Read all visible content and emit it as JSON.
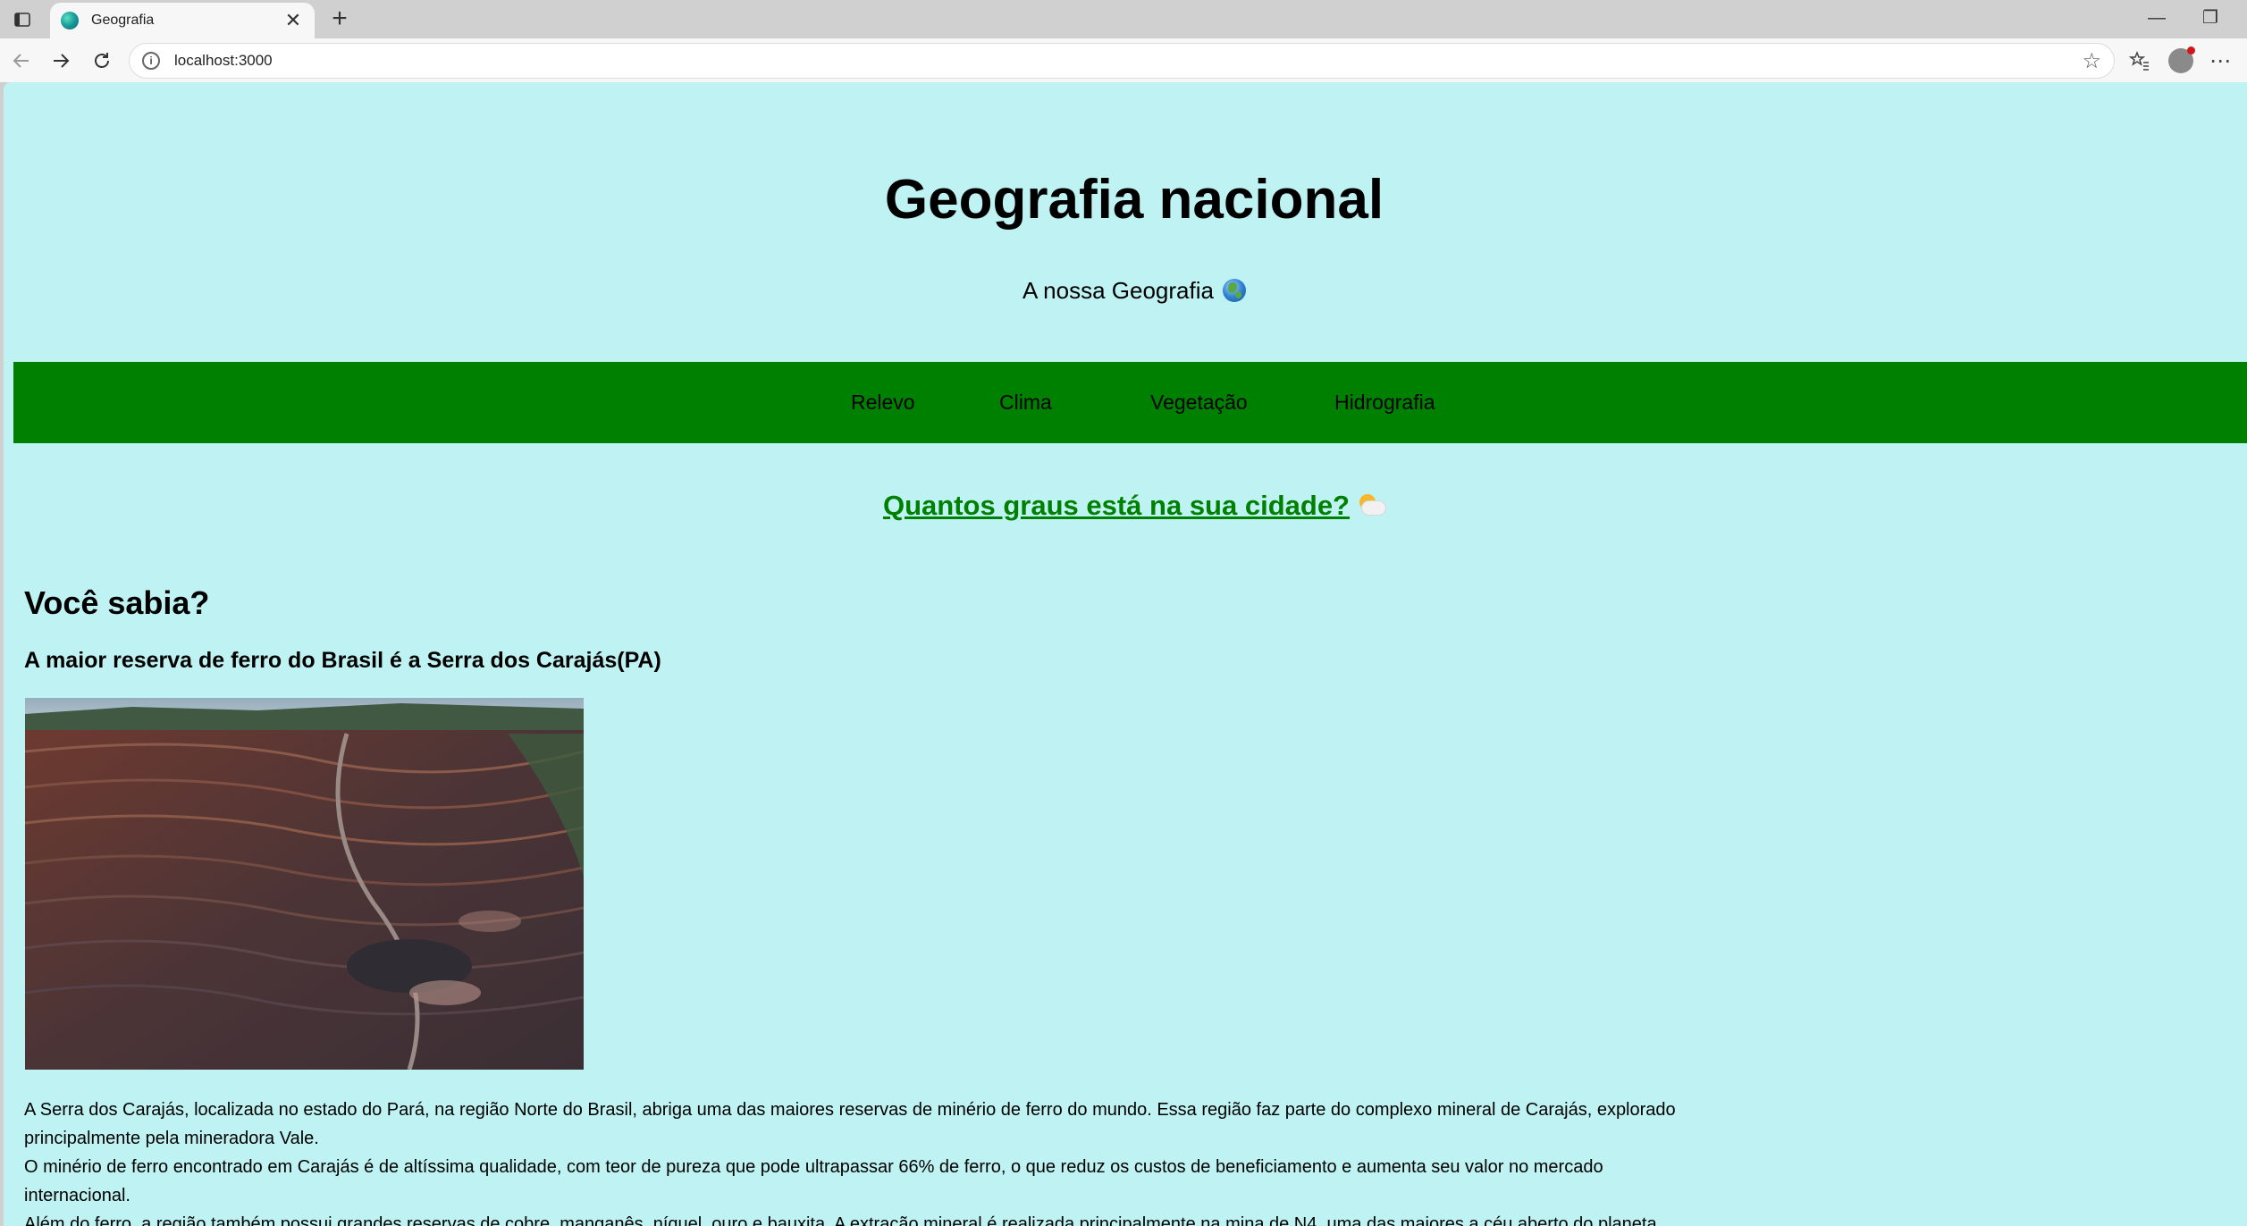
{
  "browser": {
    "tab_title": "Geografia",
    "tab_close": "✕",
    "new_tab": "+",
    "minimize": "—",
    "restore": "❐",
    "url": "localhost:3000"
  },
  "header": {
    "title": "Geografia nacional",
    "subtitle": "A nossa Geografia"
  },
  "nav": {
    "items": [
      {
        "label": "Relevo"
      },
      {
        "label": "Clima"
      },
      {
        "label": "Vegetação"
      },
      {
        "label": "Hidrografia"
      }
    ]
  },
  "weather_link": {
    "label": "Quantos graus está na sua cidade?"
  },
  "fact": {
    "section_title": "Você sabia?",
    "title": "A maior reserva de ferro do Brasil é a Serra dos Carajás(PA)",
    "paragraphs": [
      "A Serra dos Carajás, localizada no estado do Pará, na região Norte do Brasil, abriga uma das maiores reservas de minério de ferro do mundo. Essa região faz parte do complexo mineral de Carajás, explorado principalmente pela mineradora Vale.",
      "O minério de ferro encontrado em Carajás é de altíssima qualidade, com teor de pureza que pode ultrapassar 66% de ferro, o que reduz os custos de beneficiamento e aumenta seu valor no mercado internacional.",
      "Além do ferro, a região também possui grandes reservas de cobre, manganês, níquel, ouro e bauxita. A extração mineral é realizada principalmente na mina de N4, uma das maiores a céu aberto do planeta."
    ]
  },
  "icons": {
    "tab_actions": "tab-actions-icon",
    "favicon": "globe-favicon-icon",
    "back": "arrow-left-icon",
    "forward": "arrow-right-icon",
    "reload": "reload-icon",
    "site_info": "info-icon",
    "bookmark": "star-icon",
    "favorites": "favorites-icon",
    "profile": "profile-icon",
    "more": "more-icon",
    "globe_emoji": "globe-icon",
    "weather_emoji": "sun-behind-cloud-icon"
  }
}
